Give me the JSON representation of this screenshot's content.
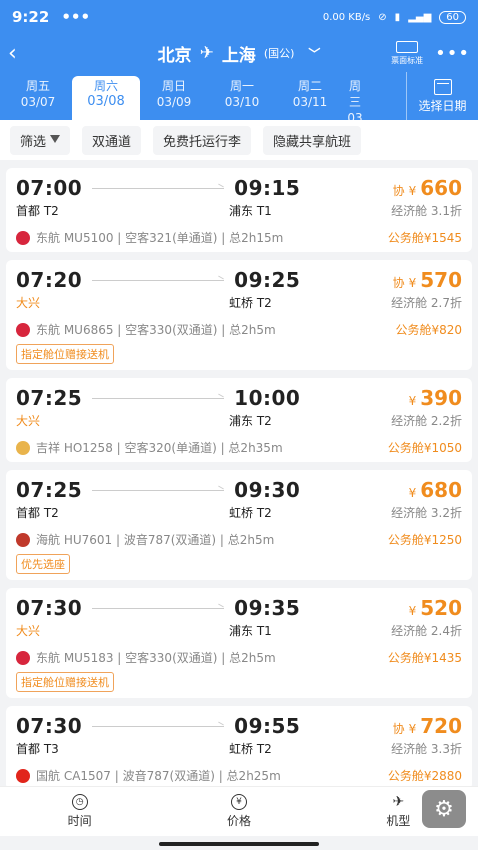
{
  "status": {
    "time": "9:22",
    "dots": "•••",
    "net": "0.00 KB/s",
    "battery": "60"
  },
  "header": {
    "from": "北京",
    "to": "上海",
    "note": "(国公)",
    "std_label": "票面标准",
    "more": "•••"
  },
  "dates": [
    {
      "w": "周五",
      "d": "03/07"
    },
    {
      "w": "周六",
      "d": "03/08",
      "active": true
    },
    {
      "w": "周日",
      "d": "03/09"
    },
    {
      "w": "周一",
      "d": "03/10"
    },
    {
      "w": "周二",
      "d": "03/11"
    },
    {
      "w": "周三",
      "d": "03"
    }
  ],
  "pick_date": "选择日期",
  "filters": [
    "筛选",
    "双通道",
    "免费托运行李",
    "隐藏共享航班"
  ],
  "flights": [
    {
      "dep": "07:00",
      "arr": "09:15",
      "dap": "首都 T2",
      "aap": "浦东 T1",
      "xie": "协",
      "price": "660",
      "cls": "经济舱 3.1折",
      "airline": "东航 MU5100 | 空客321(单通道) | 总2h15m",
      "biz": "公务舱¥1545",
      "tag": ""
    },
    {
      "dep": "07:20",
      "arr": "09:25",
      "dap": "大兴",
      "aap": "虹桥 T2",
      "xie": "协",
      "price": "570",
      "cls": "经济舱 2.7折",
      "airline": "东航 MU6865 | 空客330(双通道) | 总2h5m",
      "biz": "公务舱¥820",
      "tag": "指定舱位赠接送机"
    },
    {
      "dep": "07:25",
      "arr": "10:00",
      "dap": "大兴",
      "aap": "浦东 T2",
      "xie": "",
      "price": "390",
      "cls": "经济舱 2.2折",
      "airline": "吉祥 HO1258 | 空客320(单通道) | 总2h35m",
      "biz": "公务舱¥1050",
      "tag": ""
    },
    {
      "dep": "07:25",
      "arr": "09:30",
      "dap": "首都 T2",
      "aap": "虹桥 T2",
      "xie": "",
      "price": "680",
      "cls": "经济舱 3.2折",
      "airline": "海航 HU7601 | 波音787(双通道) | 总2h5m",
      "biz": "公务舱¥1250",
      "tag": "优先选座"
    },
    {
      "dep": "07:30",
      "arr": "09:35",
      "dap": "大兴",
      "aap": "浦东 T1",
      "xie": "",
      "price": "520",
      "cls": "经济舱 2.4折",
      "airline": "东航 MU5183 | 空客330(双通道) | 总2h5m",
      "biz": "公务舱¥1435",
      "tag": "指定舱位赠接送机"
    },
    {
      "dep": "07:30",
      "arr": "09:55",
      "dap": "首都 T3",
      "aap": "虹桥 T2",
      "xie": "协",
      "price": "720",
      "cls": "经济舱 3.3折",
      "airline": "国航 CA1507 | 波音787(双通道) | 总2h25m",
      "biz": "公务舱¥2880",
      "tag": ""
    }
  ],
  "bottom": [
    "时间",
    "价格",
    "机型"
  ],
  "colors": {
    "primary": "#3d8ef0",
    "accent": "#f08c1e"
  }
}
